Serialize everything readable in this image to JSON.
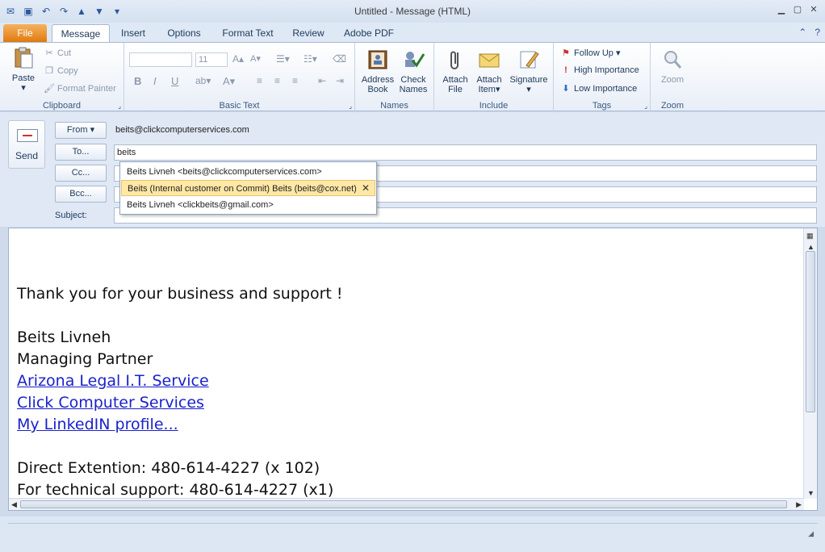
{
  "window": {
    "title": "Untitled - Message (HTML)"
  },
  "tabs": [
    {
      "label": "File"
    },
    {
      "label": "Message"
    },
    {
      "label": "Insert"
    },
    {
      "label": "Options"
    },
    {
      "label": "Format Text"
    },
    {
      "label": "Review"
    },
    {
      "label": "Adobe PDF"
    }
  ],
  "ribbon": {
    "clipboard": {
      "label": "Clipboard",
      "paste": "Paste",
      "cut": "Cut",
      "copy": "Copy",
      "format_painter": "Format Painter"
    },
    "basic_text": {
      "label": "Basic Text",
      "font_size": "11",
      "bold": "B",
      "italic": "I",
      "font_color": "A"
    },
    "names": {
      "label": "Names",
      "address_book_1": "Address",
      "address_book_2": "Book",
      "check_names_1": "Check",
      "check_names_2": "Names"
    },
    "include": {
      "label": "Include",
      "attach_file_1": "Attach",
      "attach_file_2": "File",
      "attach_item_1": "Attach",
      "attach_item_2": "Item",
      "signature": "Signature"
    },
    "tags": {
      "label": "Tags",
      "follow_up": "Follow Up",
      "high_importance": "High Importance",
      "low_importance": "Low Importance"
    },
    "zoom": {
      "label": "Zoom",
      "zoom": "Zoom"
    }
  },
  "header": {
    "send": "Send",
    "from_btn": "From",
    "from_value": "beits@clickcomputerservices.com",
    "to_btn": "To...",
    "to_value": "beits",
    "cc_btn": "Cc...",
    "bcc_btn": "Bcc...",
    "subject_label": "Subject:"
  },
  "autocomplete": [
    {
      "text": "Beits Livneh <beits@clickcomputerservices.com>"
    },
    {
      "text": "Beits (Internal customer on Commit) Beits (beits@cox.net)"
    },
    {
      "text": "Beits Livneh <clickbeits@gmail.com>"
    }
  ],
  "body": {
    "thanks": "Thank you for your business and support !",
    "name": "Beits Livneh",
    "role": "Managing Partner",
    "link1": "Arizona Legal I.T. Service",
    "link2": "Click Computer Services",
    "link3": "My LinkedIN profile...",
    "direct": "Direct Extention: 480-614-4227 (x 102)",
    "support": "For technical support: 480-614-4227 (x1)"
  },
  "colors": {
    "file_tab": "#e07a10",
    "link": "#1a22c9",
    "highlight": "#ffe8a6"
  }
}
